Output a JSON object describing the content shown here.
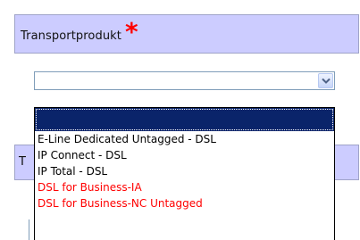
{
  "section": {
    "title": "Transportprodukt",
    "required_marker": "*"
  },
  "select": {
    "value": "",
    "options": [
      {
        "label": "",
        "selected": true,
        "color": "#000000"
      },
      {
        "label": "E-Line Dedicated Untagged - DSL",
        "selected": false,
        "color": "#000000"
      },
      {
        "label": "IP Connect - DSL",
        "selected": false,
        "color": "#000000"
      },
      {
        "label": "IP Total - DSL",
        "selected": false,
        "color": "#000000"
      },
      {
        "label": "DSL for Business-IA",
        "selected": false,
        "color": "#ff0000"
      },
      {
        "label": "DSL for Business-NC Untagged",
        "selected": false,
        "color": "#ff0000"
      }
    ]
  },
  "section2": {
    "title_partial": "T"
  },
  "colors": {
    "header_bg": "#ccccff",
    "required": "#ff0000",
    "selected_bg": "#0a246a"
  }
}
